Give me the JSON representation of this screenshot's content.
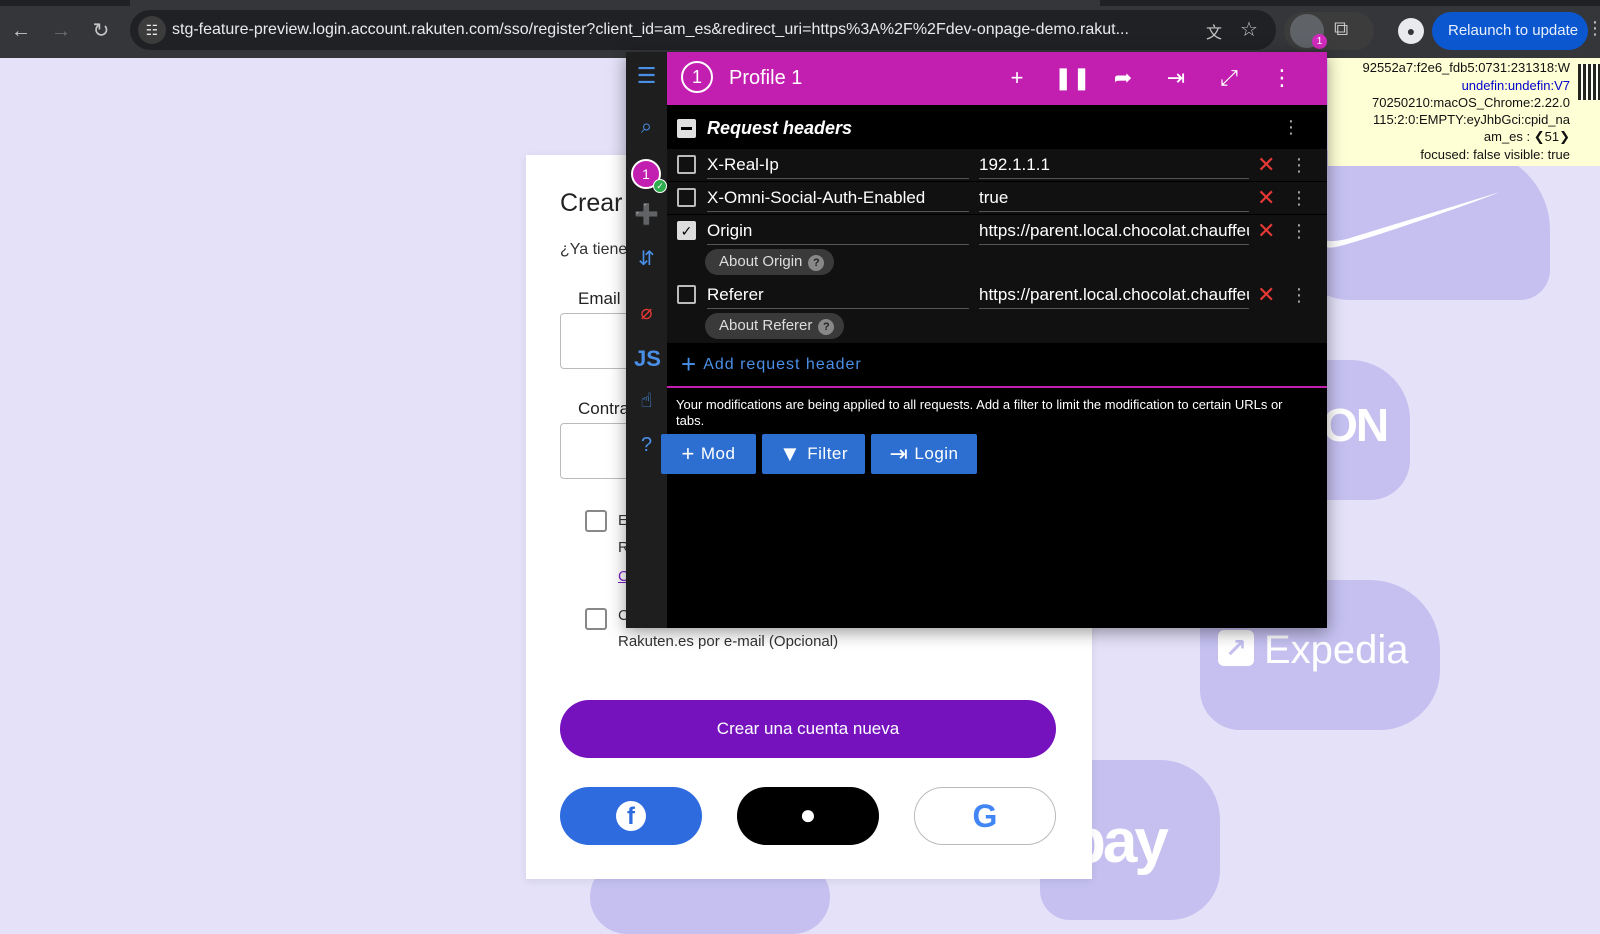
{
  "browser": {
    "url": "stg-feature-preview.login.account.rakuten.com/sso/register?client_id=am_es&redirect_uri=https%3A%2F%2Fdev-onpage-demo.rakut...",
    "relaunch_label": "Relaunch to update",
    "extension_badge": "1"
  },
  "debug": {
    "line1": "92552a7:f2e6_fdb5:0731:231318:W",
    "line2": "undefin:undefin:V7",
    "line3": "70250210:macOS_Chrome:2.22.0",
    "line4": "115:2:0:EMPTY:eyJhbGci:cpid_na",
    "line5": "am_es : ❮51❯",
    "line6": "focused: false visible: true"
  },
  "brands": {
    "lon": "LON",
    "expedia": "Expedia",
    "ebay": "bay"
  },
  "signup": {
    "title": "Crear",
    "subtitle": "¿Ya tiene",
    "email_label": "Email",
    "password_label": "Contra",
    "check1_line1": "E",
    "check1_line2": "R",
    "check1_link": "C",
    "check2_line1": "C",
    "check2_line2": "Rakuten.es por e-mail (Opcional)",
    "create_button": "Crear una cuenta nueva"
  },
  "modheader": {
    "profile_number": "1",
    "profile_title": "Profile 1",
    "section_title": "Request headers",
    "headers": [
      {
        "name": "X-Real-Ip",
        "value": "192.1.1.1",
        "enabled": false
      },
      {
        "name": "X-Omni-Social-Auth-Enabled",
        "value": "true",
        "enabled": false
      },
      {
        "name": "Origin",
        "value": "https://parent.local.chocolat.chauffeur",
        "enabled": true,
        "chip": "About Origin"
      },
      {
        "name": "Referer",
        "value": "https://parent.local.chocolat.chauffeur",
        "enabled": false,
        "chip": "About Referer"
      }
    ],
    "add_header_label": "Add request header",
    "notice": "Your modifications are being applied to all requests. Add a filter to limit the modification to certain URLs or tabs.",
    "buttons": {
      "mod": "Mod",
      "filter": "Filter",
      "login": "Login"
    },
    "rail_js": "JS"
  }
}
